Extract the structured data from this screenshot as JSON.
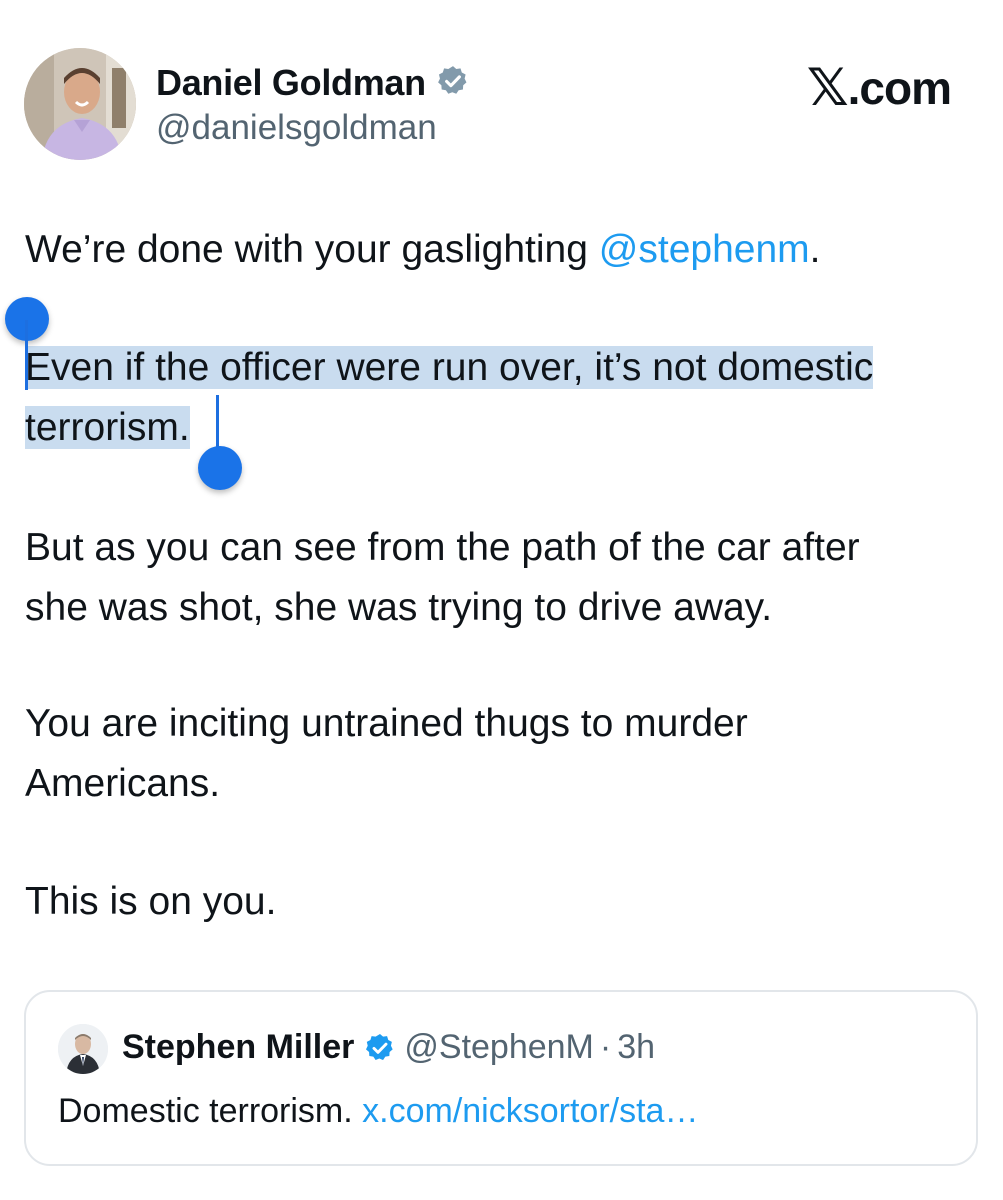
{
  "author": {
    "name": "Daniel Goldman",
    "handle": "@danielsgoldman",
    "verified_color": "#829aab"
  },
  "brand": {
    "x_glyph": "𝕏",
    "suffix": ".com"
  },
  "tweet": {
    "p1_text": "We’re done with your gaslighting ",
    "p1_mention": "@stephenm",
    "p1_end": ".",
    "p2_line1": "Even if the officer were run over, it’s not domestic",
    "p2_line2": "terrorism.",
    "p3_line1": "But as you can see from the path of the car after",
    "p3_line2": "she was shot, she was trying to drive away.",
    "p4_line1": "You are inciting untrained thugs to murder",
    "p4_line2": "Americans.",
    "p5": "This is on you."
  },
  "quote": {
    "name": "Stephen Miller",
    "handle": "@StephenM",
    "separator": "·",
    "time": "3h",
    "text": "Domestic terrorism. ",
    "link": "x.com/nicksortor/sta…",
    "verified_color": "#1d9bf0"
  },
  "colors": {
    "link": "#1d9bf0",
    "selection": "#c9dcef",
    "handle": "#1a73e8"
  }
}
